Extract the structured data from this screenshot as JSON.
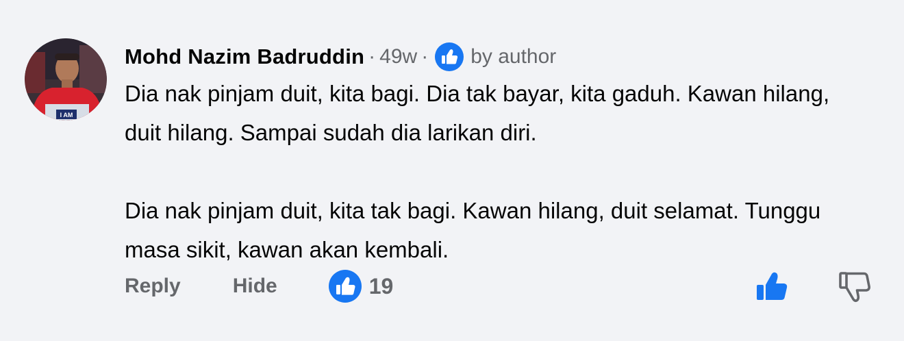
{
  "comment": {
    "author_name": "Mohd Nazim Badruddin",
    "separator": "·",
    "time_ago": "49w",
    "liked_by_label": "by author",
    "paragraphs": [
      "Dia nak pinjam duit, kita bagi. Dia tak bayar, kita gaduh. Kawan hilang, duit hilang. Sampai sudah dia larikan diri.",
      "Dia nak pinjam duit, kita tak bagi. Kawan hilang, duit selamat. Tunggu masa sikit, kawan akan kembali."
    ],
    "avatar_text": "I AM"
  },
  "actions": {
    "reply_label": "Reply",
    "hide_label": "Hide",
    "reaction_count": "19",
    "reaction_icon": "like-reaction-icon"
  },
  "right_actions": {
    "like_icon": "thumbs-up-icon",
    "dislike_icon": "thumbs-down-icon"
  },
  "colors": {
    "background": "#f2f3f6",
    "text_primary": "#050505",
    "text_secondary": "#65676b",
    "facebook_blue": "#1877f2"
  }
}
